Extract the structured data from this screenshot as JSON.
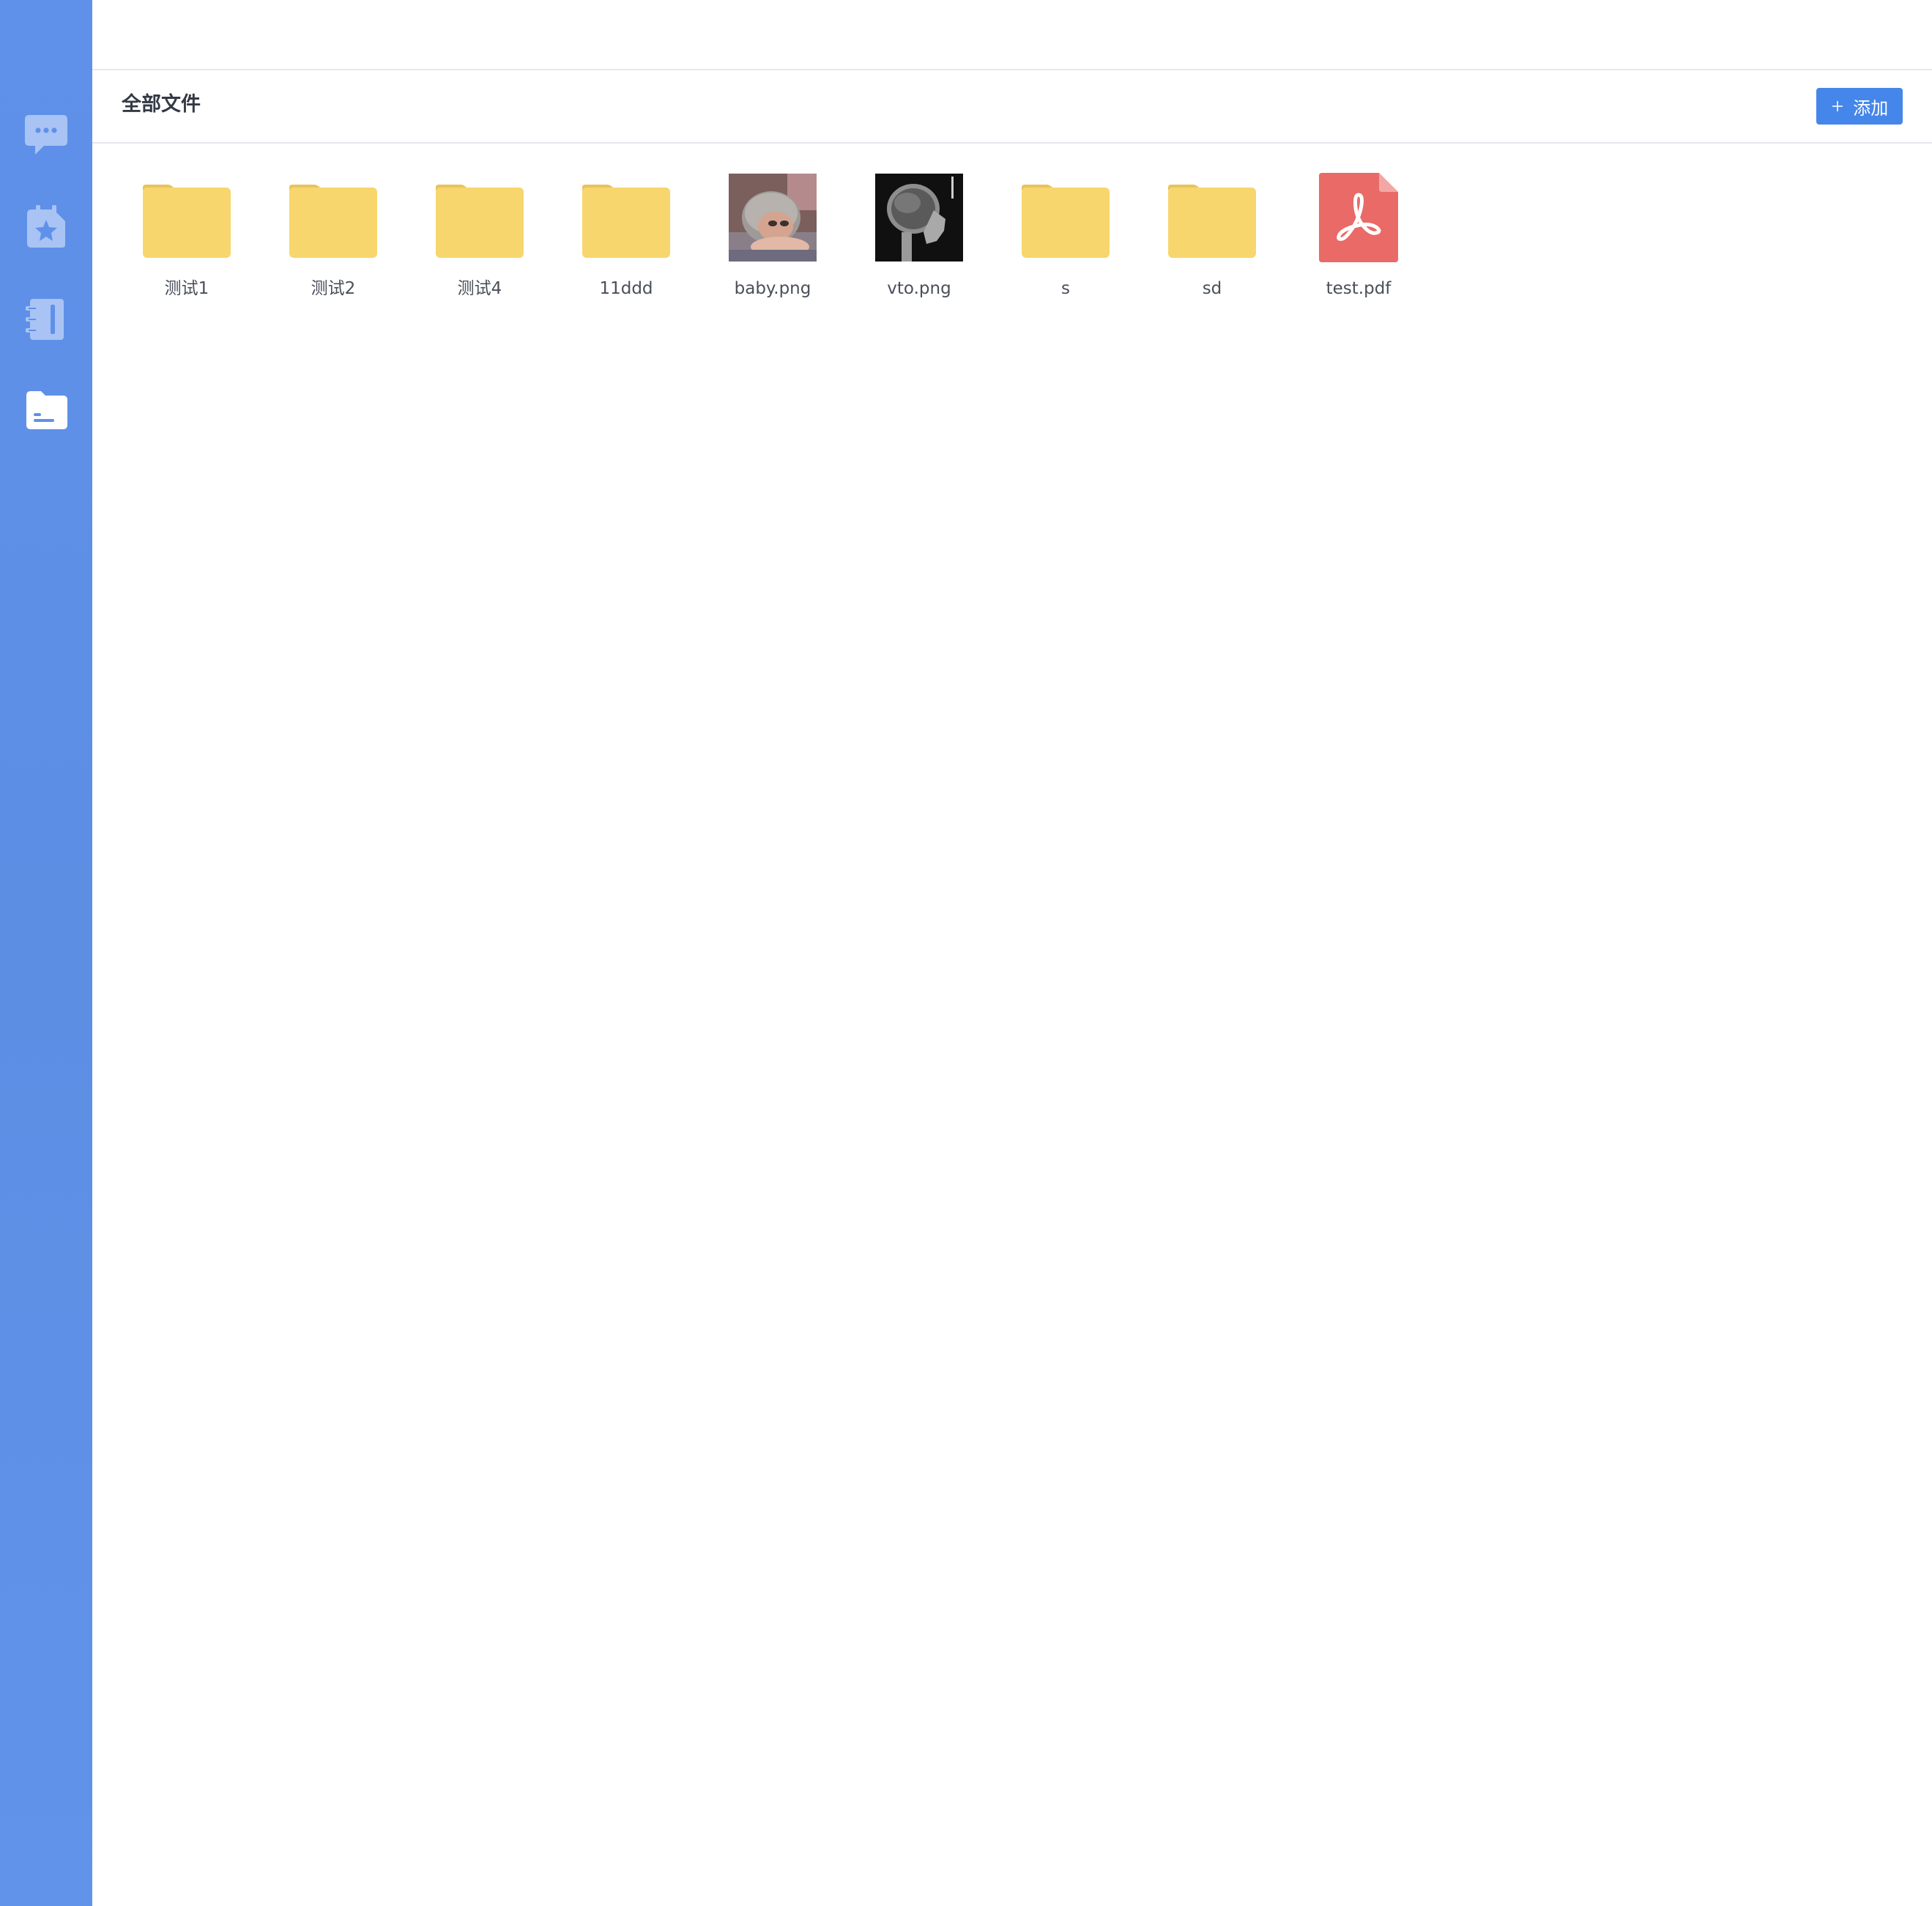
{
  "sidebar": {
    "items": [
      {
        "name": "messages",
        "icon": "chat-bubble-icon",
        "active": false
      },
      {
        "name": "starred",
        "icon": "star-tag-icon",
        "active": false
      },
      {
        "name": "notebook",
        "icon": "notebook-icon",
        "active": false
      },
      {
        "name": "files",
        "icon": "folder-file-icon",
        "active": true
      }
    ]
  },
  "header": {
    "avatar_icon": "user-avatar-icon"
  },
  "subheader": {
    "title": "全部文件",
    "add_button_label": "添加",
    "add_button_icon": "plus-icon"
  },
  "files": [
    {
      "name": "测试1",
      "type": "folder"
    },
    {
      "name": "测试2",
      "type": "folder"
    },
    {
      "name": "测试4",
      "type": "folder"
    },
    {
      "name": "11ddd",
      "type": "folder"
    },
    {
      "name": "baby.png",
      "type": "image"
    },
    {
      "name": "vto.png",
      "type": "image"
    },
    {
      "name": "s",
      "type": "folder"
    },
    {
      "name": "sd",
      "type": "folder"
    },
    {
      "name": "test.pdf",
      "type": "pdf"
    }
  ],
  "colors": {
    "sidebar": "#5f91ea",
    "accent": "#4586ea",
    "folder": "#f8d66e",
    "folder_tab": "#e9c35a",
    "pdf": "#e96a66"
  }
}
